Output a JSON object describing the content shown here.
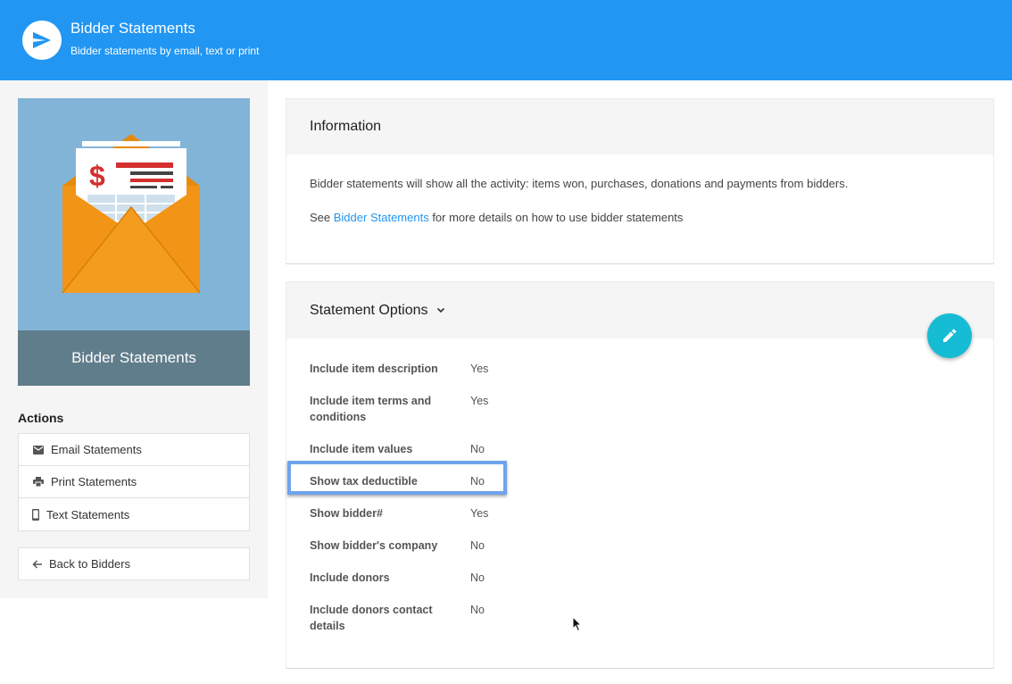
{
  "header": {
    "title": "Bidder Statements",
    "subtitle": "Bidder statements by email, text or print",
    "icon": "send-icon"
  },
  "sidebar": {
    "hero_caption": "Bidder Statements",
    "actions_title": "Actions",
    "actions": [
      {
        "label": "Email Statements",
        "icon": "email-icon"
      },
      {
        "label": "Print Statements",
        "icon": "print-icon"
      },
      {
        "label": "Text Statements",
        "icon": "phone-icon"
      }
    ],
    "back_label": "Back to Bidders"
  },
  "info": {
    "title": "Information",
    "line1": "Bidder statements will show all the activity: items won, purchases, donations and payments from bidders.",
    "line2_prefix": "See ",
    "line2_link": "Bidder Statements",
    "line2_suffix": " for more details on how to use bidder statements"
  },
  "options": {
    "title": "Statement Options",
    "rows": [
      {
        "label": "Include item description",
        "value": "Yes"
      },
      {
        "label": "Include item terms and conditions",
        "value": "Yes"
      },
      {
        "label": "Include item values",
        "value": "No"
      },
      {
        "label": "Show tax deductible",
        "value": "No"
      },
      {
        "label": "Show bidder#",
        "value": "Yes"
      },
      {
        "label": "Show bidder's company",
        "value": "No"
      },
      {
        "label": "Include donors",
        "value": "No"
      },
      {
        "label": "Include donors contact details",
        "value": "No"
      }
    ]
  },
  "colors": {
    "header_bg": "#2196f3",
    "fab_bg": "#16bcd4",
    "highlight": "#6fa4ed",
    "link": "#2196f3"
  }
}
